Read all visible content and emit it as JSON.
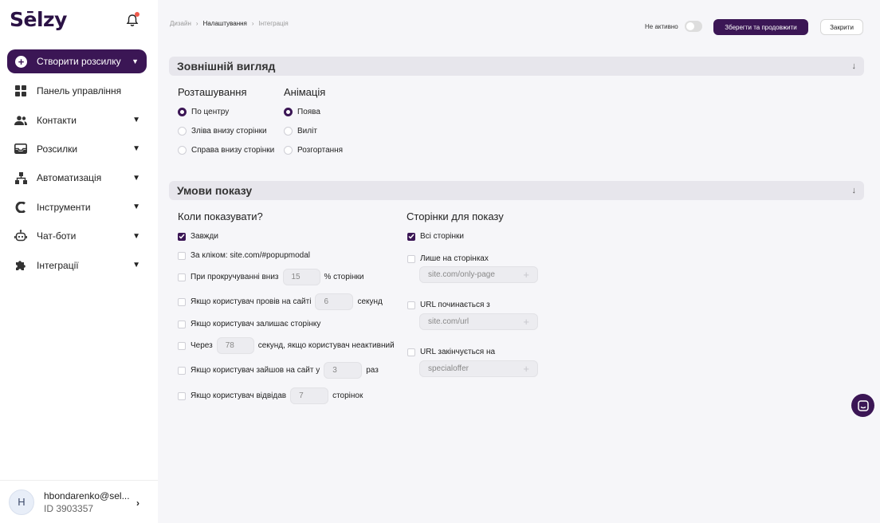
{
  "brand": {
    "logo": "Sēlzy"
  },
  "sidebar": {
    "create_label": "Створити розсилку",
    "items": [
      {
        "label": "Панель управління",
        "icon": "dashboard-icon",
        "has_chevron": false
      },
      {
        "label": "Контакти",
        "icon": "contacts-icon",
        "has_chevron": true
      },
      {
        "label": "Розсилки",
        "icon": "mail-icon",
        "has_chevron": true
      },
      {
        "label": "Автоматизація",
        "icon": "automation-icon",
        "has_chevron": true
      },
      {
        "label": "Інструменти",
        "icon": "tools-icon",
        "has_chevron": true
      },
      {
        "label": "Чат-боти",
        "icon": "chatbot-icon",
        "has_chevron": true
      },
      {
        "label": "Інтеграції",
        "icon": "puzzle-icon",
        "has_chevron": true
      }
    ],
    "user": {
      "initial": "H",
      "name": "hbondarenko@sel...",
      "id": "ID 3903357"
    }
  },
  "header": {
    "breadcrumbs": [
      "Дизайн",
      "Налаштування",
      "Інтеграція"
    ],
    "inactive_label": "Не активно",
    "save_label": "Зберегти та продовжити",
    "close_label": "Закрити"
  },
  "appearance": {
    "title": "Зовнішній вигляд",
    "position_title": "Розташування",
    "position_options": [
      "По центру",
      "Зліва внизу сторінки",
      "Справа внизу сторінки"
    ],
    "position_selected": 0,
    "animation_title": "Анімація",
    "animation_options": [
      "Поява",
      "Виліт",
      "Розгортання"
    ],
    "animation_selected": 0
  },
  "conditions": {
    "title": "Умови показу",
    "when_title": "Коли показувати?",
    "always": "Завжди",
    "on_click": "За кліком: site.com/#popupmodal",
    "scroll_pre": "При прокручуванні вниз",
    "scroll_value": "15",
    "scroll_post": "% сторінки",
    "time_pre": "Якщо користувач провів на сайті",
    "time_value": "6",
    "time_post": "секунд",
    "leave": "Якщо користувач залишає сторінку",
    "idle_pre": "Через",
    "idle_value": "78",
    "idle_post": "секунд, якщо користувач неактивний",
    "visits_pre": "Якщо користувач зайшов на сайт у",
    "visits_value": "3",
    "visits_post": "раз",
    "pages_pre": "Якщо користувач відвідав",
    "pages_value": "7",
    "pages_post": "сторінок",
    "pages_title": "Сторінки для показу",
    "all_pages": "Всі сторінки",
    "only_pages": "Лише на сторінках",
    "only_pages_placeholder": "site.com/only-page",
    "url_starts": "URL починається з",
    "url_starts_placeholder": "site.com/url",
    "url_ends": "URL закінчується на",
    "url_ends_placeholder": "specialoffer"
  },
  "colors": {
    "primary": "#3b1655",
    "accent_dot": "#ef5a4c",
    "section_bg": "#e7e6ec"
  }
}
